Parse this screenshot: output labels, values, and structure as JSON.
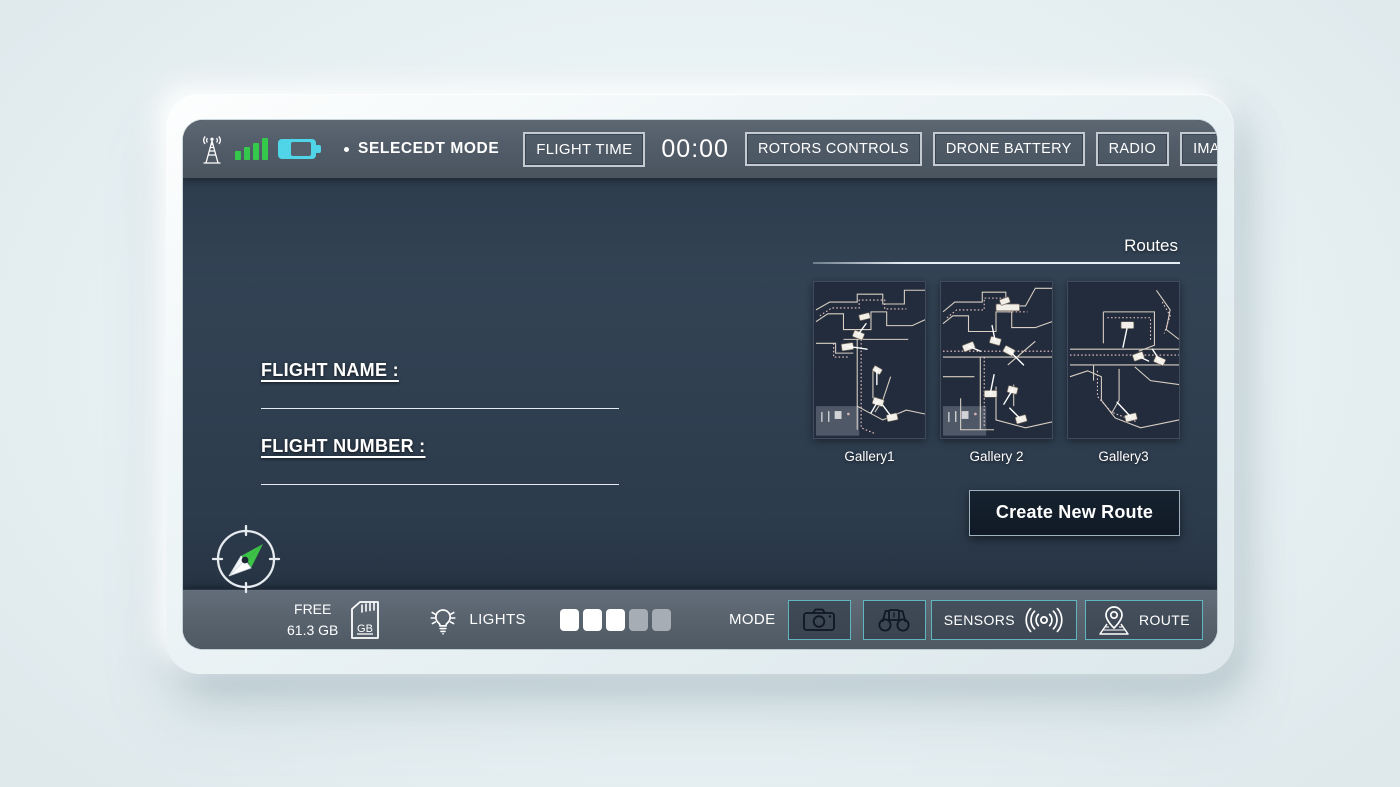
{
  "topbar": {
    "icons": {
      "tower": "cell-tower-icon",
      "signal": "signal-bars-icon",
      "battery": "battery-icon"
    },
    "mode_label": "SELECEDT MODE",
    "flight_time_button": "FLIGHT TIME",
    "flight_time_value": "00:00",
    "buttons": [
      {
        "label": "ROTORS CONTROLS",
        "name": "rotors-controls-button"
      },
      {
        "label": "DRONE BATTERY",
        "name": "drone-battery-button"
      },
      {
        "label": "RADIO",
        "name": "radio-button"
      },
      {
        "label": "IMAGES",
        "name": "images-button"
      }
    ]
  },
  "form": {
    "name_label": "FLIGHT NAME :",
    "name_value": "",
    "name_placeholder": "",
    "number_label": "FLIGHT NUMBER :",
    "number_value": "",
    "number_placeholder": ""
  },
  "routes": {
    "title": "Routes",
    "gallery": [
      {
        "caption": "Gallery1"
      },
      {
        "caption": "Gallery 2"
      },
      {
        "caption": "Gallery3"
      }
    ],
    "create_button": "Create New Route"
  },
  "bottombar": {
    "compass": "compass-icon",
    "storage": {
      "label": "FREE",
      "value": "61.3 GB",
      "icon_text": "GB"
    },
    "lights": {
      "label": "LIGHTS",
      "levels_total": 5,
      "levels_on": 3
    },
    "mode": {
      "label": "MODE",
      "photo_icon": "camera-icon",
      "scout_icon": "binoculars-icon"
    },
    "sensors": {
      "label": "SENSORS",
      "icon": "signal-waves-icon"
    },
    "route": {
      "label": "ROUTE",
      "icon": "map-pin-icon"
    }
  },
  "colors": {
    "accent_teal": "#5fb6bf",
    "battery_cyan": "#4fd4e8",
    "signal_green": "#34c94b",
    "compass_green": "#3cc247",
    "topbar_gray": "#525d69",
    "screen_dark": "#27354a"
  }
}
